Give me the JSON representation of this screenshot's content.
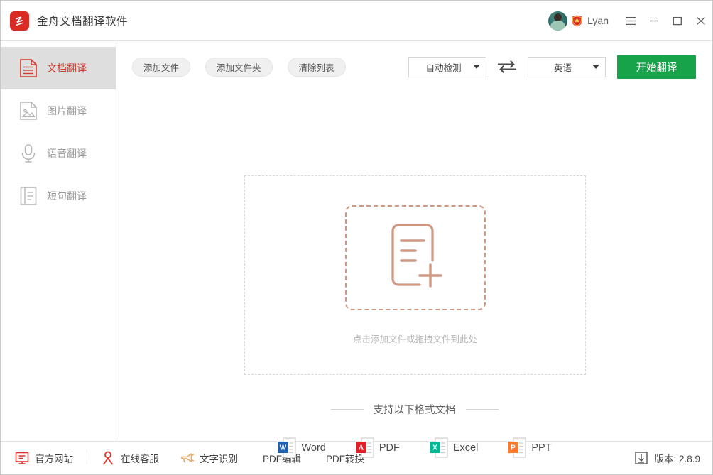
{
  "window": {
    "app_title": "金舟文档翻译软件",
    "logo_icon": "jinzhou-logo-icon",
    "controls": [
      {
        "name": "menu",
        "icon": "hamburger-menu-icon"
      },
      {
        "name": "minimize",
        "icon": "minimize-icon"
      },
      {
        "name": "maximize",
        "icon": "maximize-icon"
      },
      {
        "name": "close",
        "icon": "close-icon"
      }
    ]
  },
  "user": {
    "avatar_icon": "user-avatar",
    "vip_badge_icon": "vip-crown-badge-icon",
    "username": "Lyan"
  },
  "sidebar": {
    "items": [
      {
        "label": "文档翻译",
        "icon": "document-icon",
        "active": true
      },
      {
        "label": "图片翻译",
        "icon": "image-icon",
        "active": false
      },
      {
        "label": "语音翻译",
        "icon": "microphone-icon",
        "active": false
      },
      {
        "label": "短句翻译",
        "icon": "short-text-icon",
        "active": false
      }
    ]
  },
  "toolbar": {
    "add_file_label": "添加文件",
    "add_folder_label": "添加文件夹",
    "clear_list_label": "清除列表",
    "source_language": "自动检测",
    "target_language": "英语",
    "swap_icon": "swap-arrows-icon",
    "translate_label": "开始翻译"
  },
  "dropzone": {
    "icon": "add-document-icon",
    "hint": "点击添加文件或拖拽文件到此处"
  },
  "formats": {
    "title": "支持以下格式文档",
    "items": [
      {
        "name": "Word",
        "icon": "word-file-icon",
        "color": "#1f5fb0",
        "letter": "W"
      },
      {
        "name": "PDF",
        "icon": "pdf-file-icon",
        "color": "#e1202a",
        "letter": "A"
      },
      {
        "name": "Excel",
        "icon": "excel-file-icon",
        "color": "#00b894",
        "letter": "X"
      },
      {
        "name": "PPT",
        "icon": "ppt-file-icon",
        "color": "#fa7a2c",
        "letter": "P"
      }
    ]
  },
  "statusbar": {
    "website_label": "官方网站",
    "website_icon": "monitor-icon",
    "support_label": "在线客服",
    "support_icon": "person-icon",
    "ocr_label": "文字识别",
    "ocr_icon": "megaphone-icon",
    "pdf_edit_label": "PDF编辑",
    "pdf_convert_label": "PDF转换",
    "version_icon": "download-icon",
    "version_label": "版本: 2.8.9"
  },
  "colors": {
    "brand_red": "#d92b24",
    "accent_green": "#16a34a",
    "dropzone_border": "#cf9882",
    "active_sidebar_bg": "#dedede"
  }
}
